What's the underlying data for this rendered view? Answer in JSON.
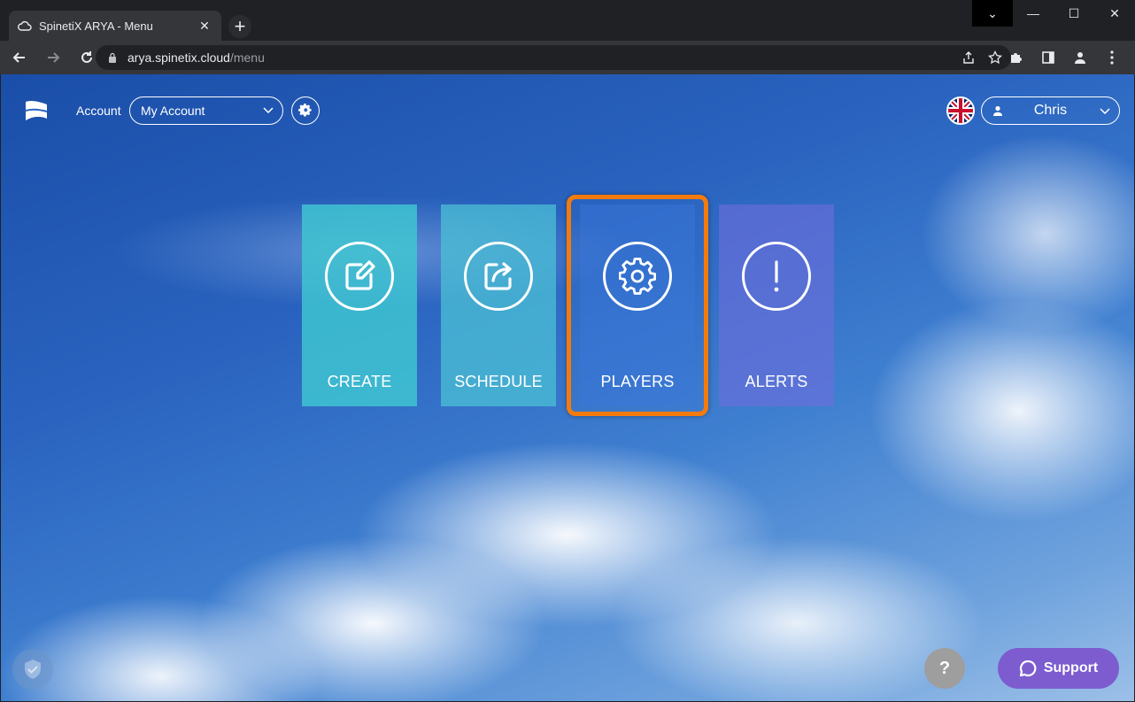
{
  "browser": {
    "tab_title": "SpinetiX ARYA - Menu",
    "tab_close_glyph": "✕",
    "new_tab_glyph": "+",
    "url_host": "arya.spinetix.cloud",
    "url_path": "/menu",
    "window_controls": [
      "⌄",
      "—",
      "☐",
      "✕"
    ]
  },
  "header": {
    "account_label": "Account",
    "account_select_value": "My Account",
    "user_name": "Chris",
    "language_flag": "uk-flag-icon"
  },
  "tiles": [
    {
      "label": "CREATE",
      "icon": "edit-icon"
    },
    {
      "label": "SCHEDULE",
      "icon": "share-icon"
    },
    {
      "label": "PLAYERS",
      "icon": "gear-icon"
    },
    {
      "label": "ALERTS",
      "icon": "exclamation-icon"
    }
  ],
  "footer": {
    "help_glyph": "?",
    "support_label": "Support"
  },
  "colors": {
    "highlight": "#f47b0b",
    "support": "#7c5ccf",
    "create_tile": "#40c8d2",
    "alerts_tile": "#6e6edc"
  }
}
